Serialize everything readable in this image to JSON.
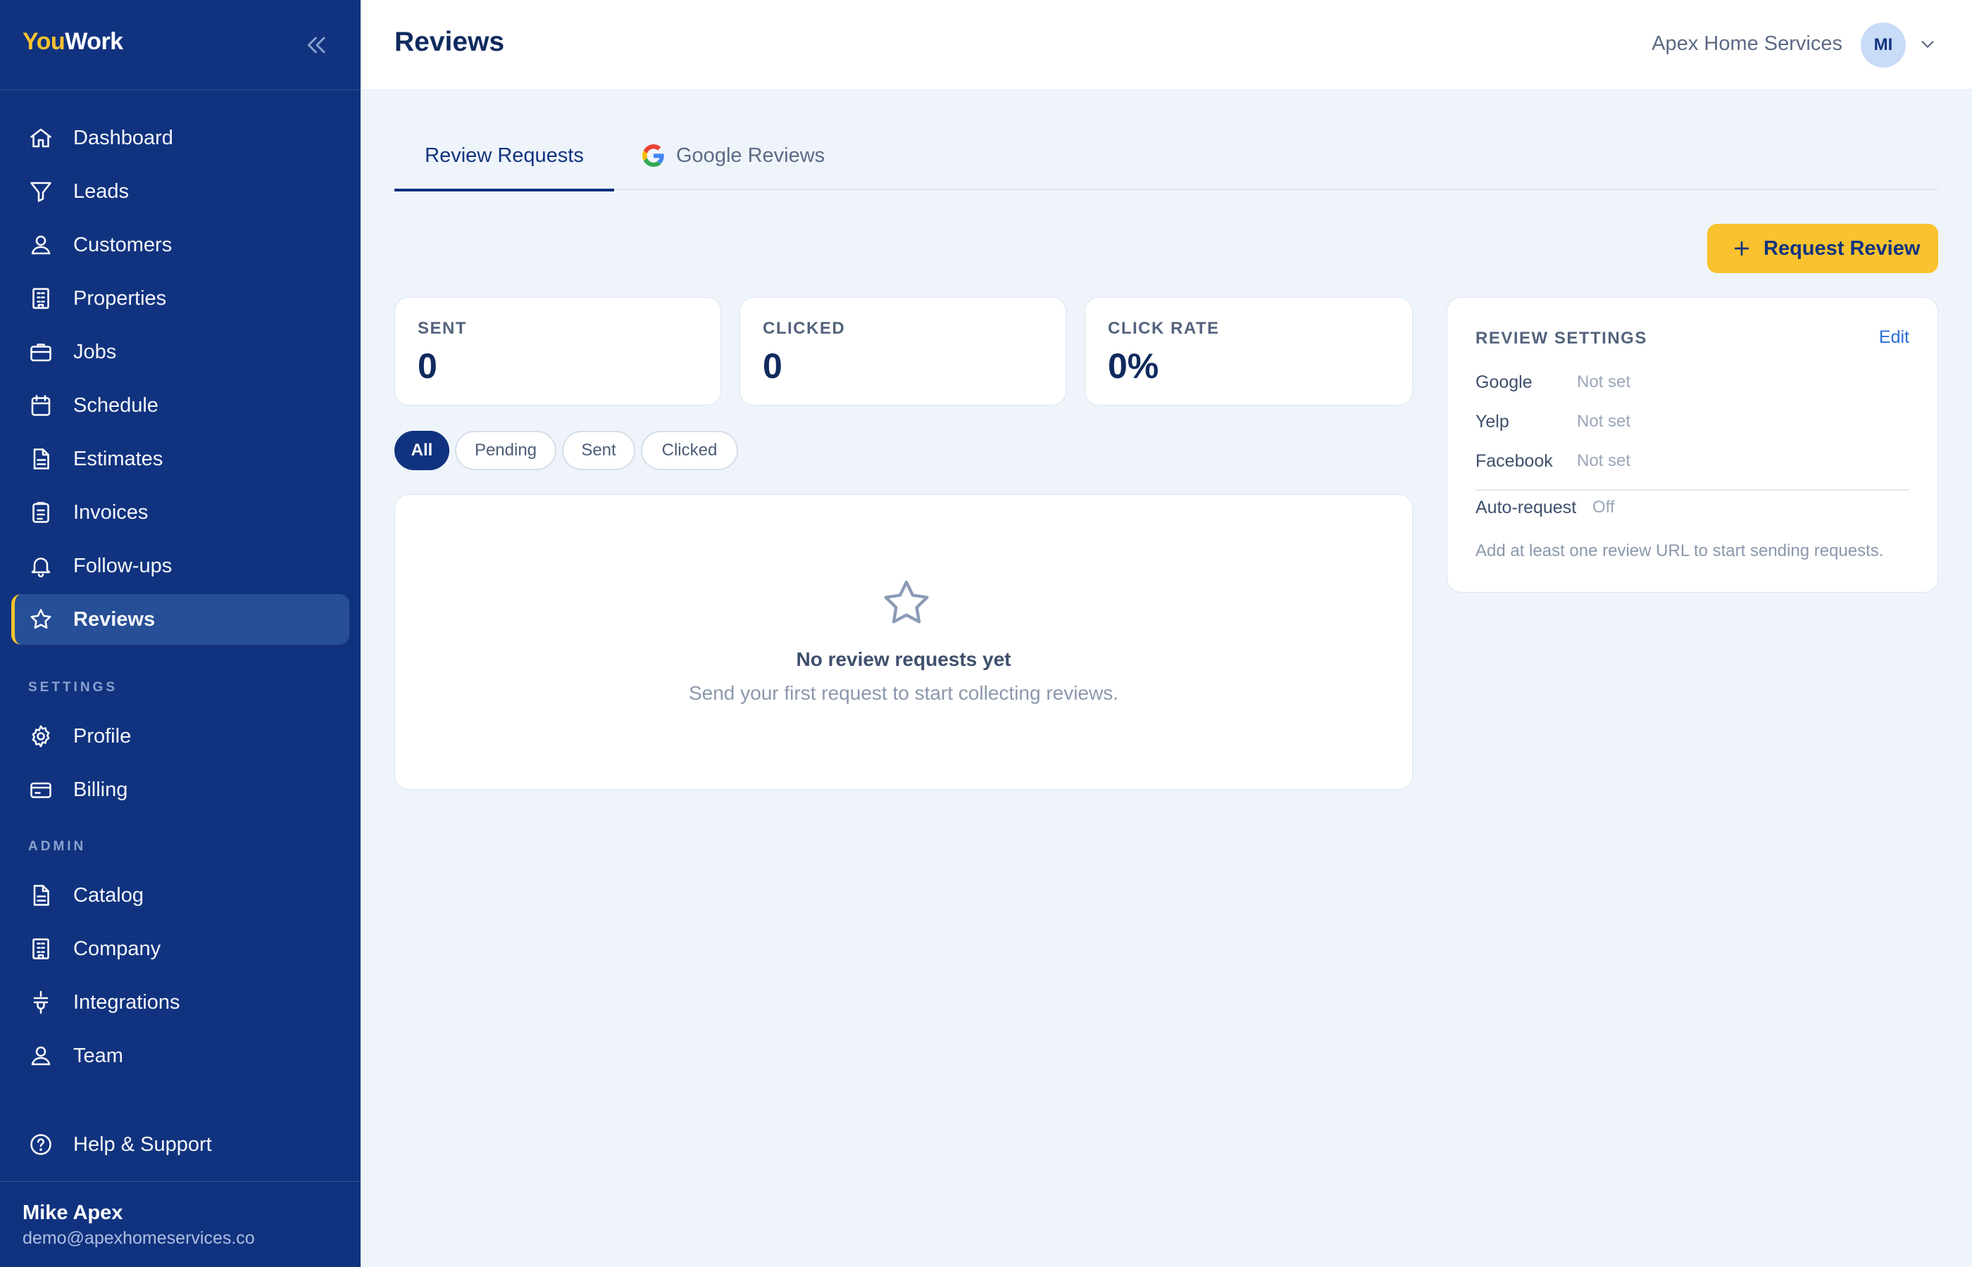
{
  "brand": {
    "part1": "You",
    "part2": "Work"
  },
  "sidebar": {
    "items": [
      {
        "label": "Dashboard",
        "icon": "home-icon"
      },
      {
        "label": "Leads",
        "icon": "funnel-icon"
      },
      {
        "label": "Customers",
        "icon": "user-icon"
      },
      {
        "label": "Properties",
        "icon": "building-icon"
      },
      {
        "label": "Jobs",
        "icon": "briefcase-icon"
      },
      {
        "label": "Schedule",
        "icon": "calendar-icon"
      },
      {
        "label": "Estimates",
        "icon": "document-icon"
      },
      {
        "label": "Invoices",
        "icon": "clipboard-icon"
      },
      {
        "label": "Follow-ups",
        "icon": "bell-icon"
      },
      {
        "label": "Reviews",
        "icon": "star-icon",
        "active": true
      }
    ],
    "settings_label": "SETTINGS",
    "settings_items": [
      {
        "label": "Profile",
        "icon": "gear-icon"
      },
      {
        "label": "Billing",
        "icon": "credit-card-icon"
      }
    ],
    "admin_label": "ADMIN",
    "admin_items": [
      {
        "label": "Catalog",
        "icon": "document-icon"
      },
      {
        "label": "Company",
        "icon": "building-icon"
      },
      {
        "label": "Integrations",
        "icon": "plug-icon"
      },
      {
        "label": "Team",
        "icon": "user-icon"
      }
    ],
    "help_label": "Help & Support",
    "user": {
      "name": "Mike Apex",
      "email": "demo@apexhomeservices.co"
    }
  },
  "header": {
    "title": "Reviews",
    "company": "Apex Home Services",
    "avatar_initials": "MI"
  },
  "tabs": [
    {
      "label": "Review Requests",
      "active": true
    },
    {
      "label": "Google Reviews",
      "active": false,
      "icon": "google-icon"
    }
  ],
  "actions": {
    "request_review": "Request Review"
  },
  "stats": [
    {
      "label": "SENT",
      "value": "0"
    },
    {
      "label": "CLICKED",
      "value": "0"
    },
    {
      "label": "CLICK RATE",
      "value": "0%"
    }
  ],
  "filters": [
    {
      "label": "All",
      "active": true
    },
    {
      "label": "Pending",
      "active": false
    },
    {
      "label": "Sent",
      "active": false
    },
    {
      "label": "Clicked",
      "active": false
    }
  ],
  "empty_state": {
    "title": "No review requests yet",
    "subtitle": "Send your first request to start collecting reviews."
  },
  "review_settings": {
    "title": "REVIEW SETTINGS",
    "edit_label": "Edit",
    "rows": [
      {
        "key": "Google",
        "value": "Not set"
      },
      {
        "key": "Yelp",
        "value": "Not set"
      },
      {
        "key": "Facebook",
        "value": "Not set"
      }
    ],
    "auto_request": {
      "key": "Auto-request",
      "value": "Off"
    },
    "note": "Add at least one review URL to start sending requests."
  },
  "colors": {
    "sidebar_bg": "#11337f",
    "accent_yellow": "#f9c22e",
    "page_bg": "#eff4fb",
    "link_blue": "#2a6fd6"
  }
}
